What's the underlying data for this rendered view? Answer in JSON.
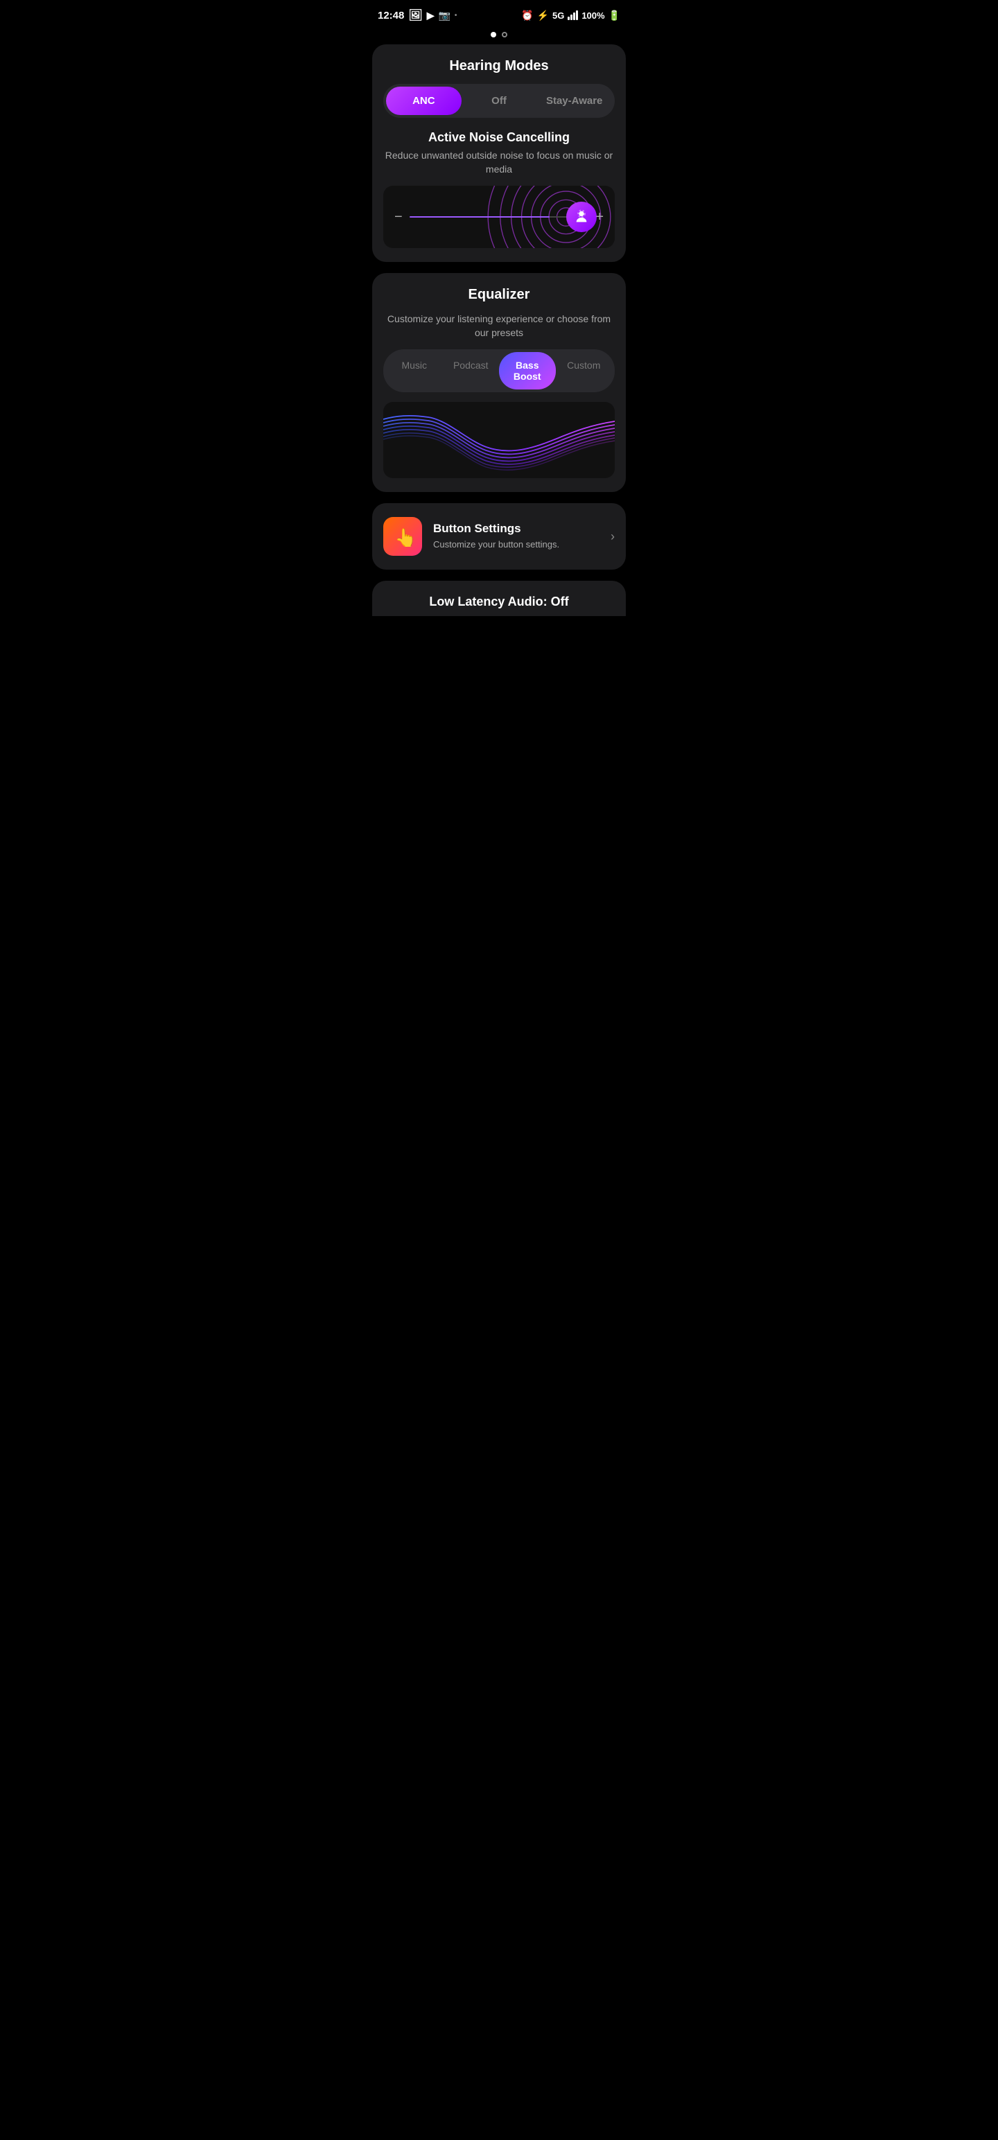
{
  "statusBar": {
    "time": "12:48",
    "battery": "100%",
    "signal": "5G"
  },
  "pageIndicators": [
    "active",
    "inactive"
  ],
  "hearingModes": {
    "title": "Hearing Modes",
    "options": [
      "ANC",
      "Off",
      "Stay-Aware"
    ],
    "activeOption": "ANC",
    "sectionTitle": "Active Noise Cancelling",
    "sectionDesc": "Reduce unwanted outside noise to focus on music or media"
  },
  "equalizer": {
    "title": "Equalizer",
    "subtitle": "Customize your listening experience or choose from our presets",
    "tabs": [
      "Music",
      "Podcast",
      "Bass Boost",
      "Custom"
    ],
    "activeTab": "Bass Boost"
  },
  "buttonSettings": {
    "title": "Button Settings",
    "desc": "Customize your button settings.",
    "chevron": "›"
  },
  "lowLatency": {
    "title": "Low Latency Audio: Off"
  }
}
